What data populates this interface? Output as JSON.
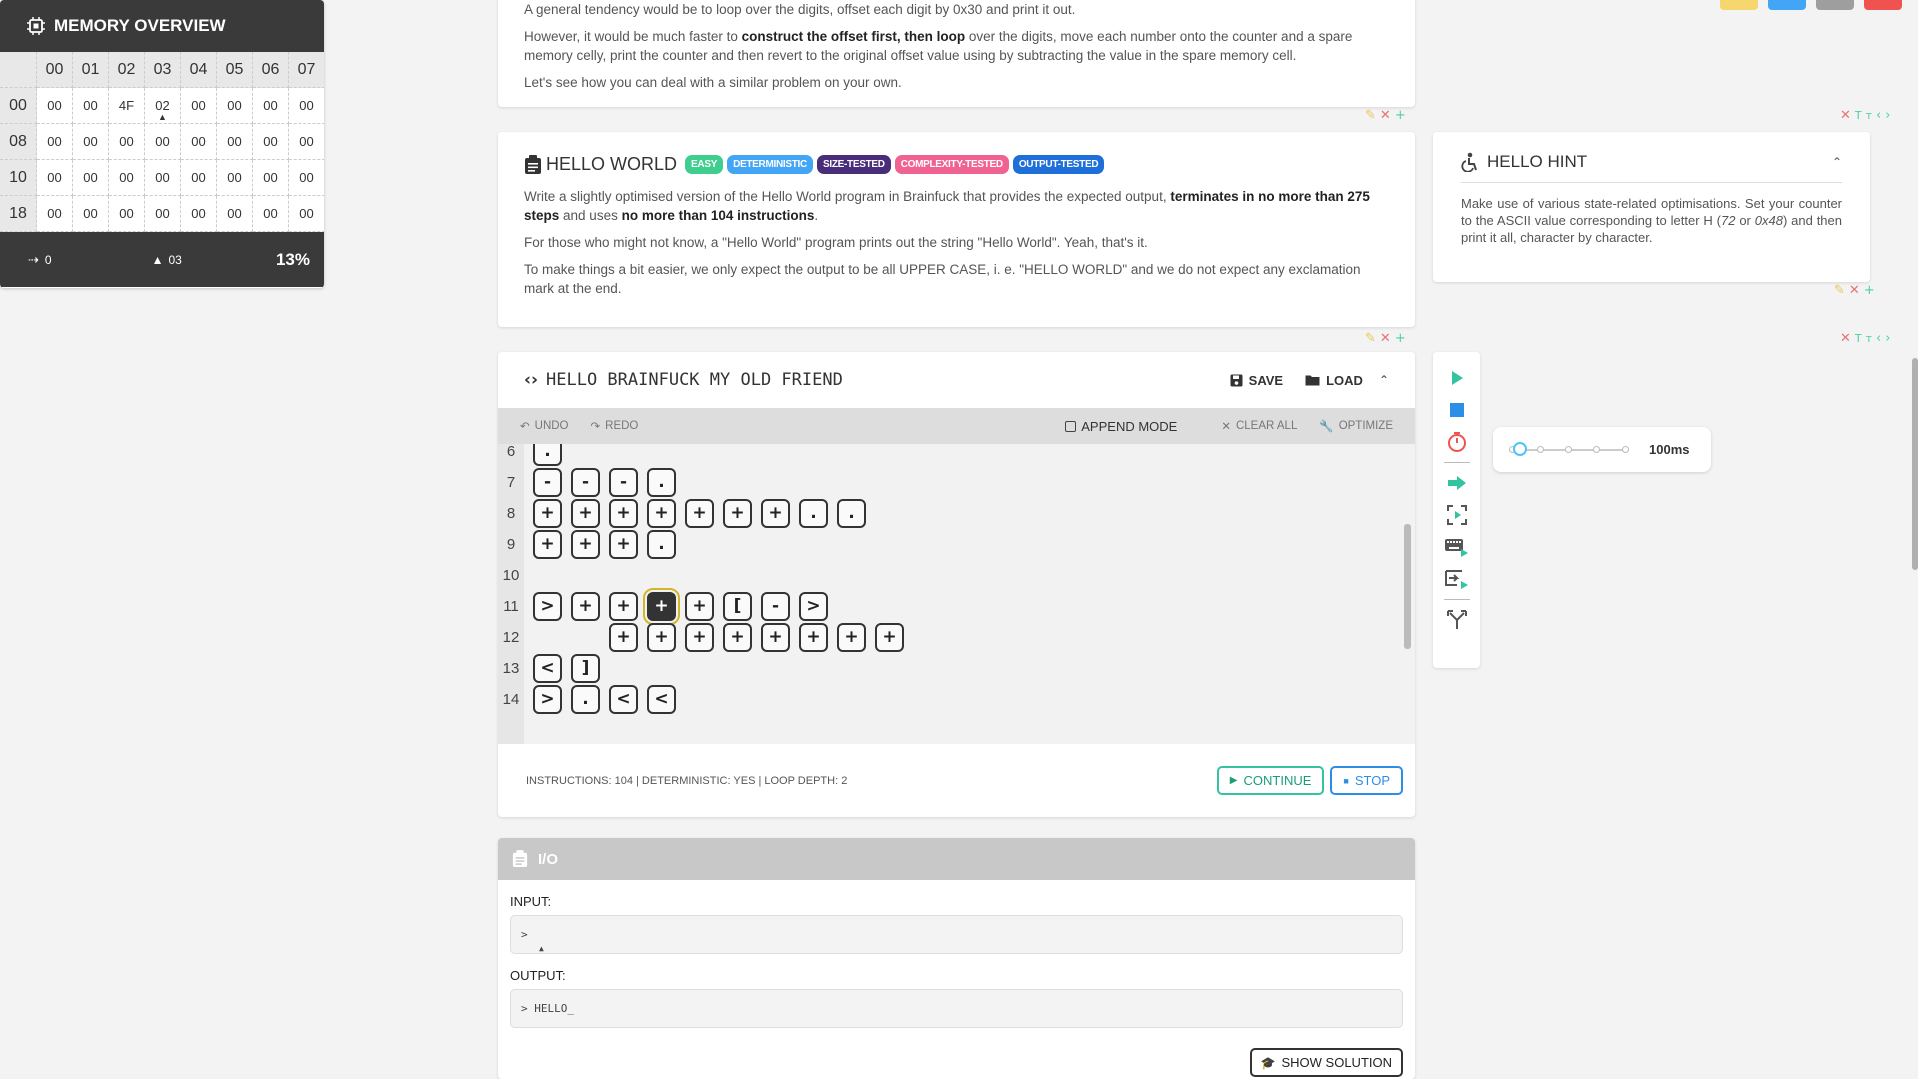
{
  "intro": {
    "line1": "A general tendency would be to loop over the digits, offset each digit by 0x30 and print it out.",
    "p2_pre": "However, it would be much faster to ",
    "p2_bold": "construct the offset first, then loop",
    "p2_post": " over the digits, move each number onto the counter and a spare memory celly, print the counter and then revert to the original offset value using by subtracting the value in the spare memory cell.",
    "p3": "Let's see how you can deal with a similar problem on your own."
  },
  "task": {
    "title": "HELLO WORLD",
    "badges": [
      {
        "label": "EASY",
        "color": "#3ecf8e"
      },
      {
        "label": "DETERMINISTIC",
        "color": "#42a5f5"
      },
      {
        "label": "SIZE-TESTED",
        "color": "#4a2d7a"
      },
      {
        "label": "COMPLEXITY-TESTED",
        "color": "#f06292"
      },
      {
        "label": "OUTPUT-TESTED",
        "color": "#1e6fd9"
      }
    ],
    "p1_pre": "Write a slightly optimised version of the Hello World program in Brainfuck that provides the expected output, ",
    "p1_bold1": "terminates in no more than 275 steps",
    "p1_mid": " and uses ",
    "p1_bold2": "no more than 104 instructions",
    "p1_post": ".",
    "p2": "For those who might not know, a \"Hello World\" program prints out the string \"Hello World\". Yeah, that's it.",
    "p3": "To make things a bit easier, we only expect the output to be all UPPER CASE, i. e. \"HELLO WORLD\" and we do not expect any exclamation mark at the end."
  },
  "hint": {
    "title": "HELLO HINT",
    "body_pre": "Make use of various state-related optimisations. Set your counter to the ASCII value corresponding to letter H (",
    "body_i1": "72",
    "body_mid": " or ",
    "body_i2": "0x48",
    "body_post": ") and then print it all, character by character."
  },
  "memory": {
    "title": "MEMORY OVERVIEW",
    "col_headers": [
      "00",
      "01",
      "02",
      "03",
      "04",
      "05",
      "06",
      "07"
    ],
    "rows": [
      {
        "label": "00",
        "cells": [
          "00",
          "00",
          "4F",
          "02",
          "00",
          "00",
          "00",
          "00"
        ]
      },
      {
        "label": "08",
        "cells": [
          "00",
          "00",
          "00",
          "00",
          "00",
          "00",
          "00",
          "00"
        ]
      },
      {
        "label": "10",
        "cells": [
          "00",
          "00",
          "00",
          "00",
          "00",
          "00",
          "00",
          "00"
        ]
      },
      {
        "label": "18",
        "cells": [
          "00",
          "00",
          "00",
          "00",
          "00",
          "00",
          "00",
          "00"
        ]
      }
    ],
    "pointer_row": 0,
    "pointer_col": 3,
    "steps": "0",
    "pointer": "03",
    "percent": "13%"
  },
  "editor": {
    "title": "HELLO BRAINFUCK MY OLD FRIEND",
    "save": "SAVE",
    "load": "LOAD",
    "undo": "UNDO",
    "redo": "REDO",
    "append_mode": "APPEND MODE",
    "clear_all": "CLEAR ALL",
    "optimize": "OPTIMIZE",
    "lines": [
      {
        "n": "6",
        "tokens": [
          "."
        ]
      },
      {
        "n": "7",
        "tokens": [
          "-",
          "-",
          "-",
          "."
        ]
      },
      {
        "n": "8",
        "tokens": [
          "+",
          "+",
          "+",
          "+",
          "+",
          "+",
          "+",
          ".",
          "."
        ]
      },
      {
        "n": "9",
        "tokens": [
          "+",
          "+",
          "+",
          "."
        ]
      },
      {
        "n": "10",
        "tokens": []
      },
      {
        "n": "11",
        "tokens": [
          ">",
          "+",
          "+",
          "+",
          "+",
          "[",
          "-",
          ">"
        ]
      },
      {
        "n": "12",
        "tokens": [
          "",
          "",
          "+",
          "+",
          "+",
          "+",
          "+",
          "+",
          "+",
          "+"
        ]
      },
      {
        "n": "13",
        "tokens": [
          "<",
          "]"
        ]
      },
      {
        "n": "14",
        "tokens": [
          ">",
          ".",
          "<",
          "<"
        ]
      }
    ],
    "active_line": 5,
    "active_token": 3,
    "status": "INSTRUCTIONS: 104 | DETERMINISTIC: YES | LOOP DEPTH: 2",
    "continue": "CONTINUE",
    "stop": "STOP"
  },
  "speed": {
    "label": "100ms",
    "value_fraction": 0.08
  },
  "io": {
    "title": "I/O",
    "input_label": "INPUT:",
    "input_value": ">",
    "output_label": "OUTPUT:",
    "output_value": "> HELLO_",
    "show_solution": "SHOW SOLUTION"
  },
  "colors": {
    "swatches": [
      "#f5d76e",
      "#42a5f5",
      "#9e9e9e",
      "#ef5350"
    ],
    "accent_green": "#34c3a0",
    "accent_blue": "#2d8ee8"
  }
}
